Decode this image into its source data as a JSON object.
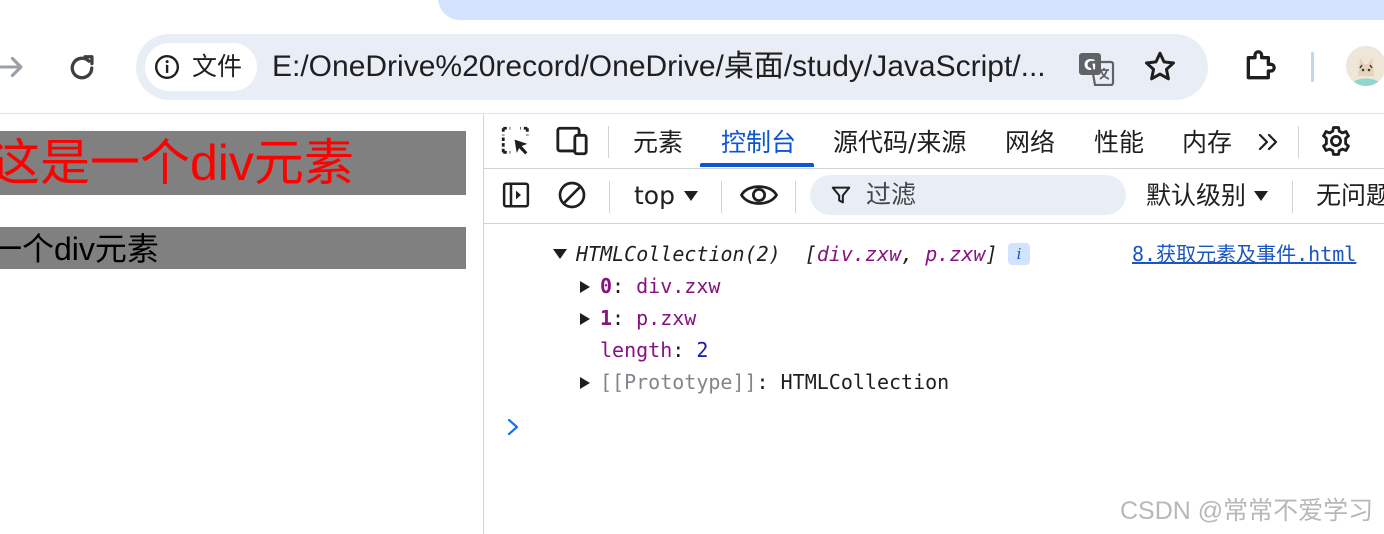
{
  "browser": {
    "site_info_label": "文件",
    "url": "E:/OneDrive%20record/OneDrive/桌面/study/JavaScript/..."
  },
  "page": {
    "box1_text": "这是一个div元素",
    "box2_text": "一个div元素"
  },
  "devtools": {
    "tabs": [
      "元素",
      "控制台",
      "源代码/来源",
      "网络",
      "性能",
      "内存"
    ],
    "active_tab_index": 1,
    "context": "top",
    "filter_placeholder": "过滤",
    "log_level": "默认级别",
    "issues": "无问题"
  },
  "console": {
    "summary_type": "HTMLCollection(2)",
    "summary_preview_open": "[",
    "summary_item1": "div.zxw",
    "summary_sep": ",",
    "summary_item2": "p.zxw",
    "summary_preview_close": "]",
    "info_badge": "i",
    "source": "8.获取元素及事件.html",
    "items": [
      {
        "key": "0",
        "sep": ": ",
        "value": "div.zxw"
      },
      {
        "key": "1",
        "sep": ": ",
        "value": "p.zxw"
      }
    ],
    "length_key": "length",
    "length_sep": ": ",
    "length_value": "2",
    "proto_key": "[[Prototype]]",
    "proto_sep": ": ",
    "proto_value": "HTMLCollection"
  },
  "watermark": "CSDN @常常不爱学习",
  "colors": {
    "accent": "#0b57d0",
    "box_bg": "#808080",
    "box1_text": "#ff0000"
  }
}
